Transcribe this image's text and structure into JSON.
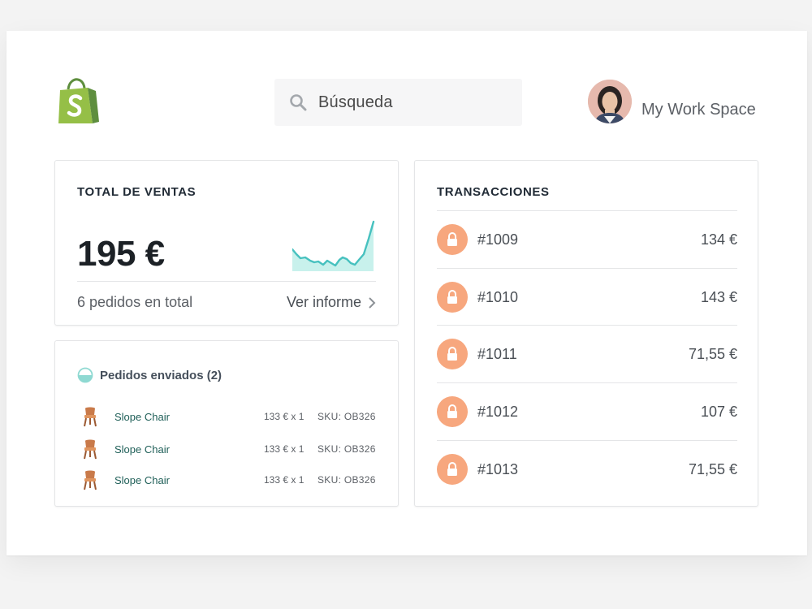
{
  "header": {
    "logo_icon": "shopify-bag-icon",
    "search": {
      "placeholder": "Búsqueda",
      "icon": "search-icon"
    },
    "workspace_name": "My Work Space",
    "avatar_icon": "user-avatar"
  },
  "sales_card": {
    "title": "TOTAL DE VENTAS",
    "amount": "195 €",
    "orders_text": "6 pedidos en total",
    "report_link": "Ver informe",
    "sparkline_color": "#47c1bf"
  },
  "shipped_card": {
    "title": "Pedidos enviados (2)",
    "items": [
      {
        "name": "Slope Chair",
        "price": "133 € x 1",
        "sku": "SKU: OB326"
      },
      {
        "name": "Slope Chair",
        "price": "133 € x 1",
        "sku": "SKU: OB326"
      },
      {
        "name": "Slope Chair",
        "price": "133 € x 1",
        "sku": "SKU: OB326"
      }
    ]
  },
  "transactions_card": {
    "title": "TRANSACCIONES",
    "rows": [
      {
        "id": "#1009",
        "amount": "134 €"
      },
      {
        "id": "#1010",
        "amount": "143 €"
      },
      {
        "id": "#1011",
        "amount": "71,55 €"
      },
      {
        "id": "#1012",
        "amount": "107 €"
      },
      {
        "id": "#1013",
        "amount": "71,55 €"
      }
    ],
    "lock_color": "#f7a77e"
  },
  "colors": {
    "brand_green": "#95bf47",
    "teal": "#47c1bf",
    "link_green": "#1f5f58"
  }
}
